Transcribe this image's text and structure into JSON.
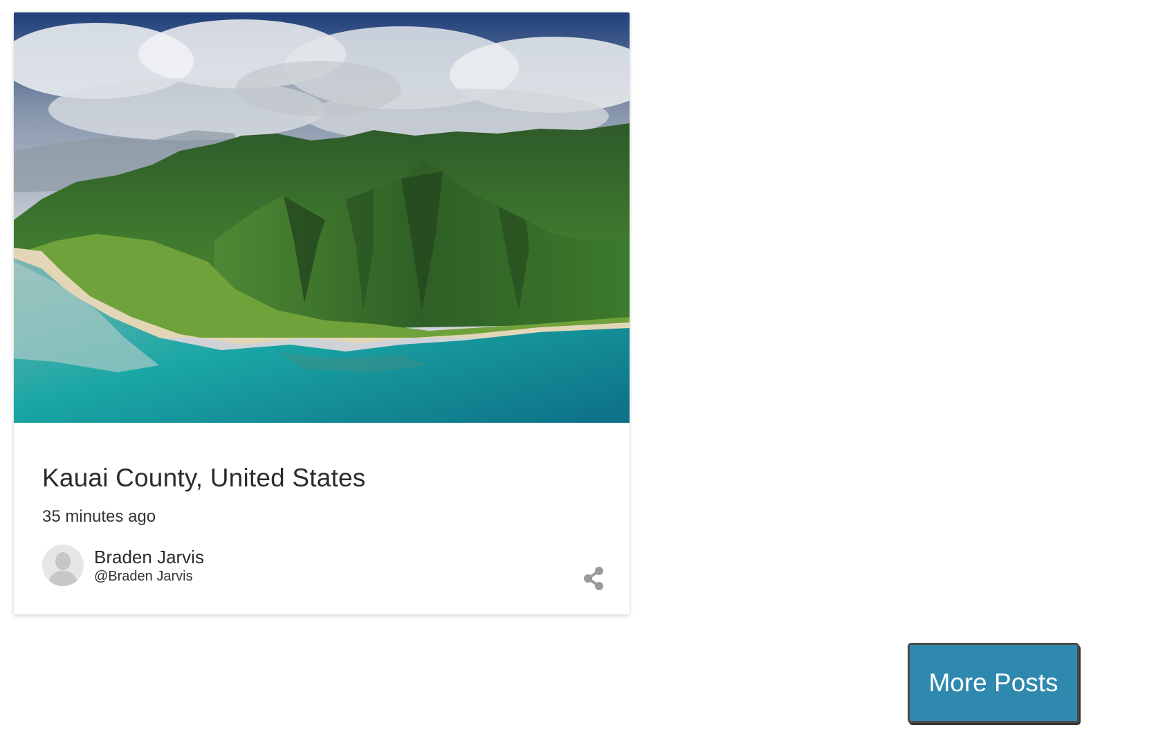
{
  "card": {
    "title": "Kauai County, United States",
    "time": "35 minutes ago",
    "author": {
      "name": "Braden Jarvis",
      "handle": "@Braden Jarvis"
    },
    "icons": {
      "avatar": "default-user-avatar",
      "share": "share-icon"
    }
  },
  "actions": {
    "more_posts_label": "More Posts"
  },
  "colors": {
    "button_bg": "#2f88ad",
    "share_icon": "#9a9a9a",
    "avatar_bg": "#e6e6e6"
  }
}
